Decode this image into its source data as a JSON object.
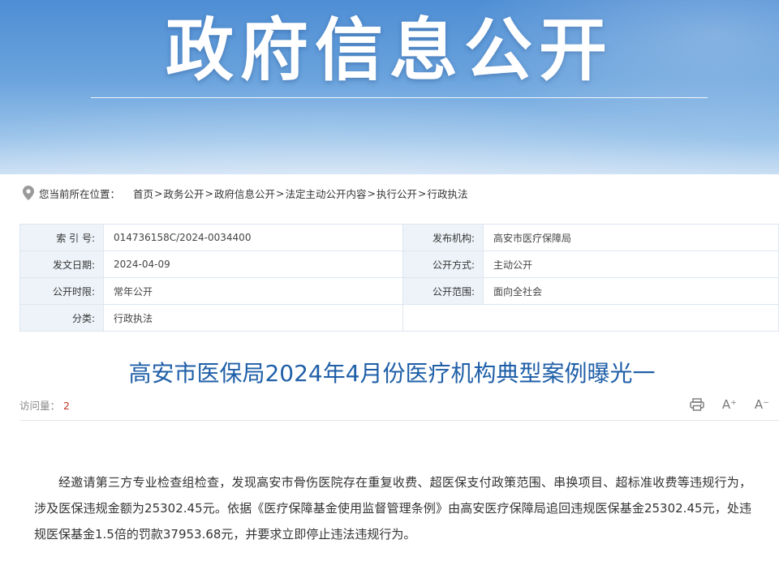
{
  "banner": {
    "title": "政府信息公开"
  },
  "breadcrumb": {
    "label": "您当前所在位置：",
    "items": [
      "首页",
      "政务公开",
      "政府信息公开",
      "法定主动公开内容",
      "执行公开",
      "行政执法"
    ],
    "separator": ">"
  },
  "meta": {
    "index_label": "索 引 号:",
    "index_value": "014736158C/2024-0034400",
    "publisher_label": "发布机构:",
    "publisher_value": "高安市医疗保障局",
    "date_label": "发文日期:",
    "date_value": "2024-04-09",
    "method_label": "公开方式:",
    "method_value": "主动公开",
    "period_label": "公开时限:",
    "period_value": "常年公开",
    "scope_label": "公开范围:",
    "scope_value": "面向全社会",
    "category_label": "分类:",
    "category_value": "行政执法"
  },
  "article": {
    "title": "高安市医保局2024年4月份医疗机构典型案例曝光一",
    "visits_label": "访问量：",
    "visits_value": "2",
    "body": "经邀请第三方专业检查组检查，发现高安市骨伤医院存在重复收费、超医保支付政策范围、串换项目、超标准收费等违规行为，涉及医保违规金额为25302.45元。依据《医疗保障基金使用监督管理条例》由高安医疗保障局追回违规医保基金25302.45元，处违规医保基金1.5倍的罚款37953.68元，并要求立即停止违法违规行为。"
  },
  "tools": {
    "font_increase": "A⁺",
    "font_decrease": "A⁻"
  },
  "colors": {
    "title_blue": "#1f5fa8",
    "label_bg": "#eef3f9",
    "visits_red": "#c0392b"
  }
}
